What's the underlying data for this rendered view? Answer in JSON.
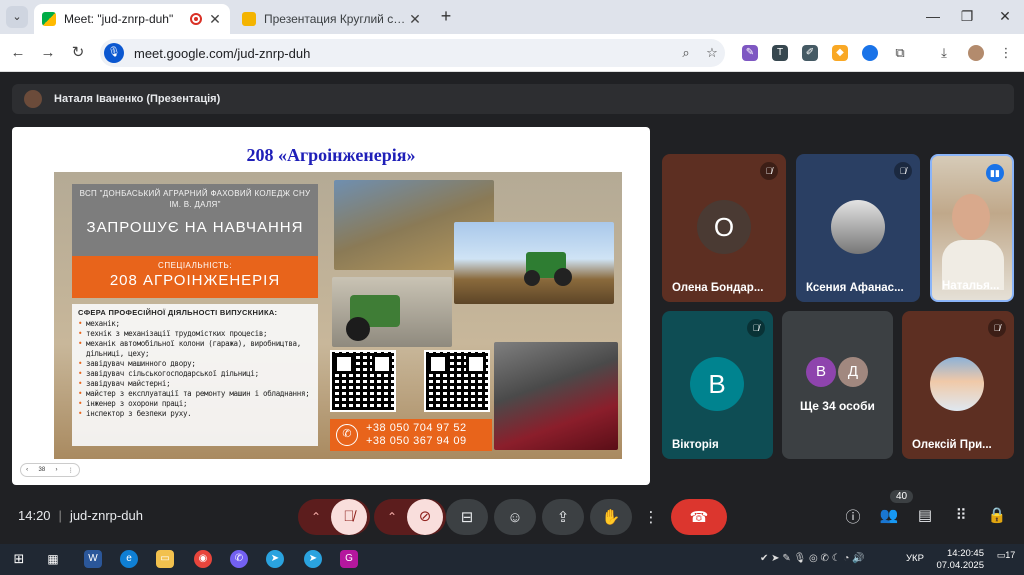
{
  "browser": {
    "tabs": [
      {
        "title": "Meet: \"jud-znrp-duh\"",
        "active": true
      },
      {
        "title": "Презентация Круглий стіл «Мо",
        "active": false
      }
    ],
    "url": "meet.google.com/jud-znrp-duh"
  },
  "presenter": {
    "label": "Наталя Іваненко (Презентація)"
  },
  "slide": {
    "title": "208 «Агроінженерія»",
    "org": "ВСП \"ДОНБАСЬКИЙ АГРАРНИЙ ФАХОВИЙ КОЛЕДЖ СНУ ІМ. В. ДАЛЯ\"",
    "invite": "ЗАПРОШУЄ НА НАВЧАННЯ",
    "specialty_label": "СПЕЦІАЛЬНІСТЬ:",
    "specialty": "208 АГРОІНЖЕНЕРІЯ",
    "duties_heading": "СФЕРА ПРОФЕСІЙНОЇ ДІЯЛЬНОСТІ ВИПУСКНИКА:",
    "duties": [
      "механік;",
      "технік з механізації трудомістких процесів;",
      "механік автомобільної колони (гаража), виробництва, дільниці, цеху;",
      "завідувач машинного двору;",
      "завідувач сільськогосподарської дільниці;",
      "завідувач майстерні;",
      "майстер з експлуатації та ремонту машин і обладнання;",
      "інженер з охорони праці;",
      "інспектор з безпеки руху."
    ],
    "phones": [
      "+38 050 704 97 52",
      "+38 050 367 94 09"
    ],
    "page": "38"
  },
  "participants": [
    {
      "name": "Олена Бондар...",
      "initial": "О",
      "muted": true
    },
    {
      "name": "Ксения Афанас...",
      "muted": true
    },
    {
      "name": "Наталья...",
      "speaking": true
    },
    {
      "name": "Вікторія",
      "initial": "В",
      "muted": true
    },
    {
      "name": "Ще 34 особи",
      "initials": [
        "В",
        "Д"
      ]
    },
    {
      "name": "Олексій При...",
      "muted": true
    }
  ],
  "meeting": {
    "time": "14:20",
    "code": "jud-znrp-duh",
    "people_count": "40"
  },
  "taskbar": {
    "lang": "УКР",
    "time": "14:20:45",
    "date": "07.04.2025",
    "notifications": "17"
  },
  "colors": {
    "accent_orange": "#e8641b",
    "hangup": "#dc362e",
    "slide_title": "#1f1fb8"
  }
}
